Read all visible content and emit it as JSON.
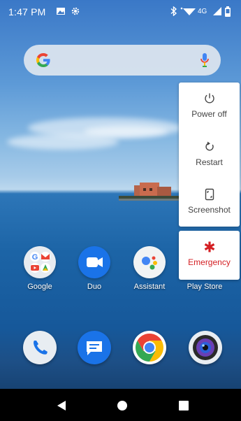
{
  "status_bar": {
    "time": "1:47 PM",
    "network": "4G",
    "left_icons": [
      "image-icon",
      "gear-icon"
    ],
    "right_icons": [
      "bluetooth-icon",
      "wifi-icon",
      "signal-icon",
      "battery-icon"
    ]
  },
  "search_bar": {
    "left_icon": "google-g-icon",
    "right_icon": "mic-icon"
  },
  "power_menu": {
    "items": [
      {
        "label": "Power off",
        "icon": "power-icon"
      },
      {
        "label": "Restart",
        "icon": "restart-icon"
      },
      {
        "label": "Screenshot",
        "icon": "screenshot-icon"
      }
    ],
    "emergency": {
      "label": "Emergency",
      "icon": "emergency-icon",
      "color": "#d41f23"
    }
  },
  "home_apps": [
    {
      "label": "Google",
      "icon": "google-folder-icon"
    },
    {
      "label": "Duo",
      "icon": "duo-icon"
    },
    {
      "label": "Assistant",
      "icon": "assistant-icon"
    },
    {
      "label": "Play Store",
      "icon": "play-store-icon"
    }
  ],
  "dock": [
    {
      "name": "phone",
      "icon": "phone-icon"
    },
    {
      "name": "messages",
      "icon": "messages-icon"
    },
    {
      "name": "chrome",
      "icon": "chrome-icon"
    },
    {
      "name": "camera",
      "icon": "camera-icon"
    }
  ],
  "nav_bar": [
    "back-button",
    "home-button",
    "recents-button"
  ],
  "colors": {
    "accent_red": "#d41f23",
    "google_blue": "#4285f4",
    "google_red": "#ea4335",
    "google_yellow": "#fbbc05",
    "google_green": "#34a853"
  }
}
